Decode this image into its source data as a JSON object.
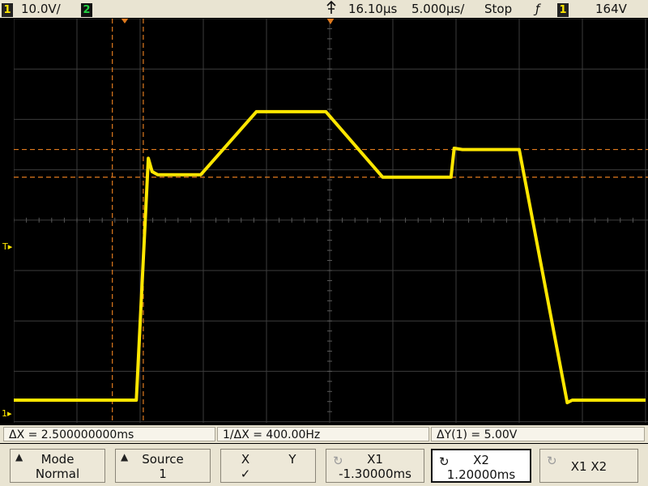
{
  "topbar": {
    "ch1_num": "1",
    "ch1_scale": "10.0V/",
    "ch2_num": "2",
    "delay": "16.10µs",
    "timebase": "5.000µs/",
    "run_state": "Stop",
    "trigger_slope": "ƒ",
    "trigger_source": "1",
    "trigger_level": "164V"
  },
  "measurements": {
    "delta_x": "ΔX = 2.500000000ms",
    "inv_delta_x": "1/ΔX = 400.00Hz",
    "delta_y": "ΔY(1) = 5.00V"
  },
  "softkeys": {
    "mode_label": "Mode",
    "mode_value": "Normal",
    "source_label": "Source",
    "source_value": "1",
    "x_label": "X",
    "x_check": "✓",
    "y_label": "Y",
    "x1_label": "X1",
    "x1_value": "-1.30000ms",
    "x2_label": "X2",
    "x2_value": "1.20000ms",
    "x1x2_label": "X1 X2"
  },
  "markers": {
    "trigger_level_mark": "T",
    "ground_mark": "1"
  },
  "colors": {
    "trace": "#ffe600",
    "cursor": "#e07a1e",
    "grid": "#3c3c3c",
    "panel": "#e9e4d2"
  },
  "trace_points": [
    [
      0,
      0.9
    ],
    [
      9.7,
      0.9
    ],
    [
      10.65,
      10.5
    ],
    [
      10.95,
      9.97
    ],
    [
      11.4,
      9.85
    ],
    [
      14.8,
      9.85
    ],
    [
      19.2,
      12.35
    ],
    [
      24.7,
      12.35
    ],
    [
      29.2,
      9.75
    ],
    [
      34.6,
      9.75
    ],
    [
      34.85,
      10.9
    ],
    [
      35.5,
      10.85
    ],
    [
      40.0,
      10.85
    ],
    [
      43.8,
      0.8
    ],
    [
      44.2,
      0.9
    ],
    [
      50,
      0.9
    ]
  ],
  "cursors": {
    "x1_div": 7.8,
    "x2_div": 10.25,
    "y1_div": 10.85,
    "y2_div": 9.75
  }
}
